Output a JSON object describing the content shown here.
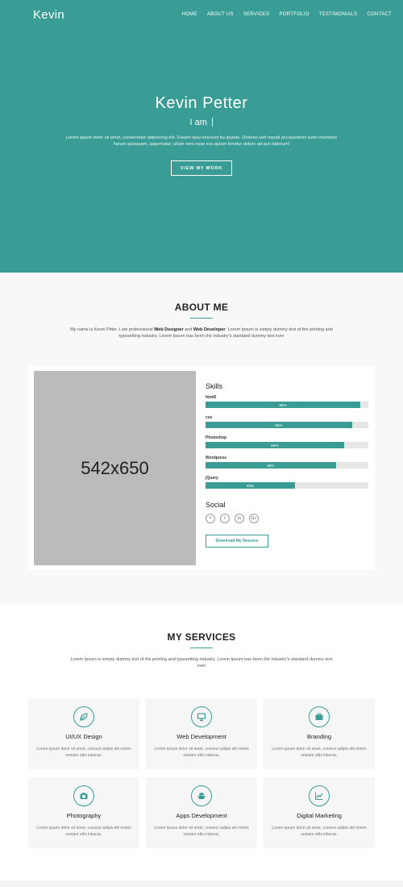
{
  "brand": {
    "logo": "Kevin",
    "accent_color": "#3a9d95"
  },
  "nav": {
    "items": [
      "HOME",
      "ABOUT US",
      "SERVICES",
      "PORTFOLIO",
      "TESTIMONIALS",
      "CONTACT"
    ]
  },
  "hero": {
    "title": "Kevin Petter",
    "subtitle": "I am",
    "description": "Lorem ipsum dolor sit amet, consectetur adipiscing elit. Fusem Ipsu nesciunt bu lputate. Dolores sed repudi accusantium iusto inventore harum quisquam, aspernatur, ullam vero esse eos ipsam tenetur dolore ad quo laborum!",
    "button": "VIEW MY WORK"
  },
  "about": {
    "title": "ABOUT ME",
    "desc_part1": "My name is Kevin Pitter. I am professional ",
    "desc_bold1": "Web Designer",
    "desc_part2": " and ",
    "desc_bold2": "Web Developer",
    "desc_part3": ". Lorem Ipsum is simply dummy text of the printing and typesetting industry. Lorem Ipsum has been the industry's standard dummy text ever",
    "image_placeholder": "542x650",
    "skills_title": "Skills",
    "skills": [
      {
        "name": "html5",
        "percent": 95,
        "label": "95%"
      },
      {
        "name": "css",
        "percent": 90,
        "label": "90%"
      },
      {
        "name": "Photoshop",
        "percent": 85,
        "label": "85%"
      },
      {
        "name": "Wordpress",
        "percent": 80,
        "label": "80%"
      },
      {
        "name": "jQuery",
        "percent": 55,
        "label": "55%"
      }
    ],
    "social_title": "Social",
    "social_icons": [
      {
        "icon": "facebook-icon",
        "glyph": "f"
      },
      {
        "icon": "twitter-icon",
        "glyph": "t"
      },
      {
        "icon": "linkedin-icon",
        "glyph": "in"
      },
      {
        "icon": "google-plus-icon",
        "glyph": "G+"
      }
    ],
    "resume_button": "Download My Resume"
  },
  "services": {
    "title": "MY SERVICES",
    "intro": "Lorem Ipsum is simply dummy text of the printing and typesetting industry. Lorem Ipsum has been the industry's standard dummy text ever",
    "items": [
      {
        "title": "UI/UX Design",
        "icon": "leaf-icon",
        "desc": "Lorem ipsum dolor sit amet, consect adipis elit minim veniam etlis inkeras."
      },
      {
        "title": "Web Development",
        "icon": "monitor-icon",
        "desc": "Lorem ipsum dolor sit amet, consect adipis elit minim veniam etlis inkeras."
      },
      {
        "title": "Branding",
        "icon": "briefcase-icon",
        "desc": "Lorem ipsum dolor sit amet, consect adipis elit minim veniam etlis inkeras."
      },
      {
        "title": "Photography",
        "icon": "camera-icon",
        "desc": "Lorem ipsum dolor sit amet, consect adipis elit minim veniam etlis inkeras."
      },
      {
        "title": "Apps Development",
        "icon": "android-icon",
        "desc": "Lorem ipsum dolor sit amet, consect adipis elit minim veniam etlis inkeras."
      },
      {
        "title": "Digital Marketing",
        "icon": "chart-line-icon",
        "desc": "Lorem ipsum dolor sit amet, consect adipis elit minim veniam etlis inkeras."
      }
    ]
  }
}
